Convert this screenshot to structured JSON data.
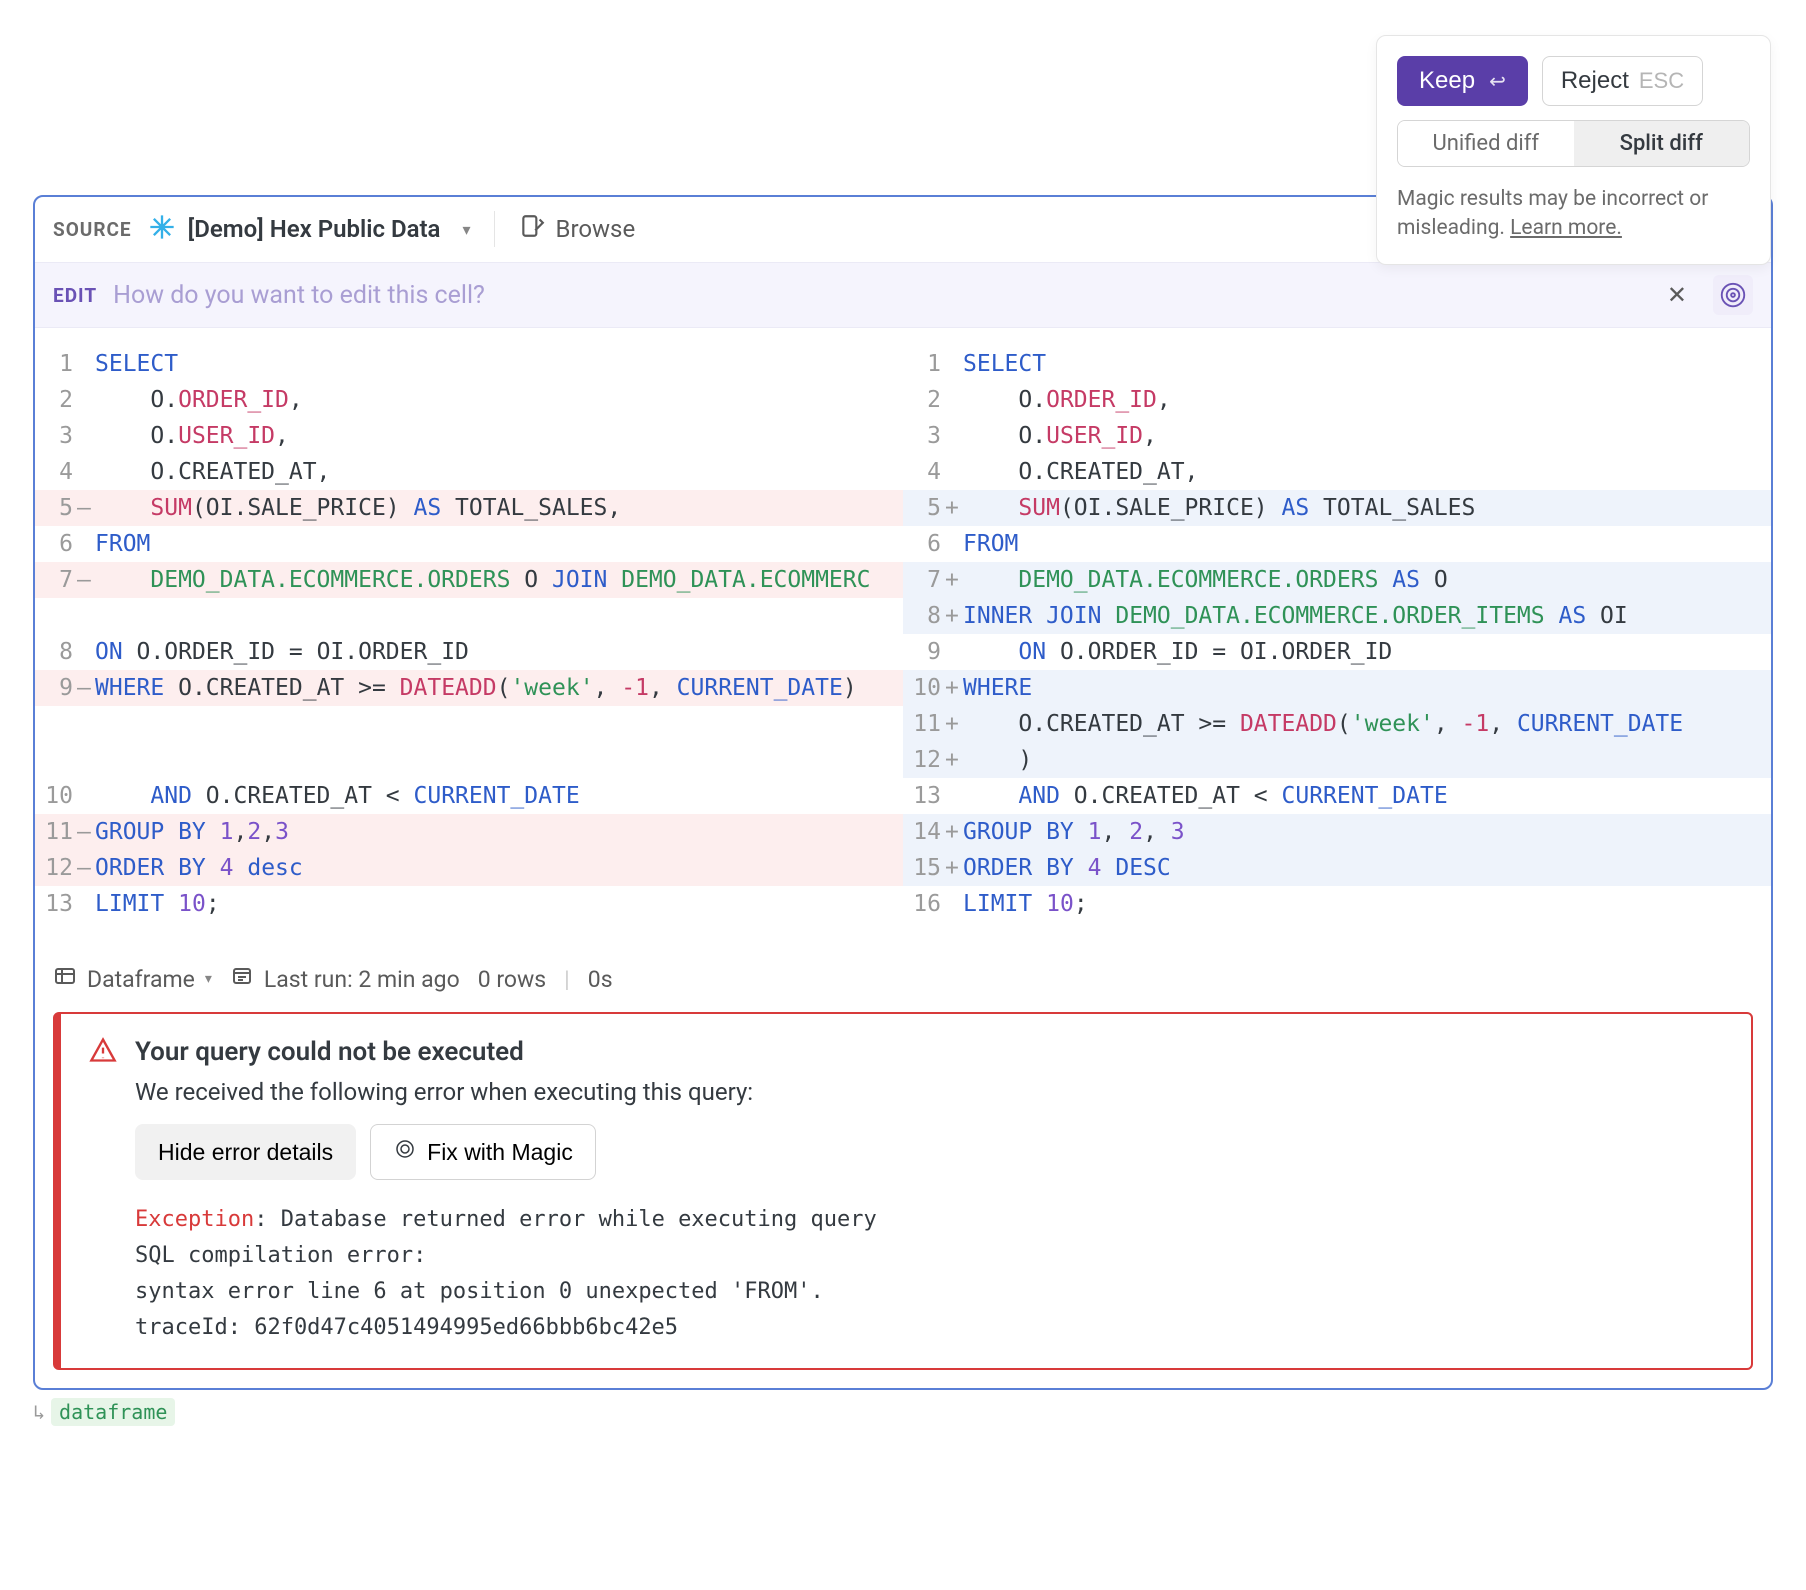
{
  "popup": {
    "keep": "Keep",
    "reject": "Reject",
    "esc": "ESC",
    "unified": "Unified diff",
    "split": "Split diff",
    "hint_prefix": "Magic results may be incorrect or misleading. ",
    "hint_link": "Learn more."
  },
  "header": {
    "source_label": "SOURCE",
    "source_name": "[Demo] Hex Public Data",
    "browse": "Browse"
  },
  "editbar": {
    "label": "EDIT",
    "placeholder": "How do you want to edit this cell?"
  },
  "diff": {
    "left": [
      {
        "n": "1",
        "m": "",
        "bg": "",
        "h": "<span class='kw'>SELECT</span>"
      },
      {
        "n": "2",
        "m": "",
        "bg": "",
        "h": "    O.<span class='col'>ORDER_ID</span>,"
      },
      {
        "n": "3",
        "m": "",
        "bg": "",
        "h": "    O.<span class='col'>USER_ID</span>,"
      },
      {
        "n": "4",
        "m": "",
        "bg": "",
        "h": "    O.CREATED_AT,"
      },
      {
        "n": "5",
        "m": "–",
        "bg": "del",
        "h": "    <span class='fn'>SUM</span>(OI.SALE_PRICE) <span class='as'>AS</span> TOTAL_SALES,"
      },
      {
        "n": "6",
        "m": "",
        "bg": "",
        "h": "<span class='kw'>FROM</span>"
      },
      {
        "n": "7",
        "m": "–",
        "bg": "del",
        "h": "    <span class='tbl'>DEMO_DATA.ECOMMERCE.ORDERS</span> O <span class='kw'>JOIN</span> <span class='tbl'>DEMO_DATA.ECOMMERC</span>"
      },
      {
        "n": "",
        "m": "",
        "bg": "",
        "h": "&nbsp;"
      },
      {
        "n": "8",
        "m": "",
        "bg": "",
        "h": "<span class='kw'>ON</span> O.ORDER_ID = OI.ORDER_ID"
      },
      {
        "n": "9",
        "m": "–",
        "bg": "del",
        "h": "<span class='kw'>WHERE</span> O.CREATED_AT &gt;= <span class='fn'>DATEADD</span>(<span class='str'>'week'</span>, <span class='neg1'>-1</span>, <span class='kw'>CURRENT_DATE</span>)"
      },
      {
        "n": "",
        "m": "",
        "bg": "",
        "h": "&nbsp;"
      },
      {
        "n": "",
        "m": "",
        "bg": "",
        "h": "&nbsp;"
      },
      {
        "n": "10",
        "m": "",
        "bg": "",
        "h": "    <span class='kw'>AND</span> O.CREATED_AT &lt; <span class='kw'>CURRENT_DATE</span>"
      },
      {
        "n": "11",
        "m": "–",
        "bg": "del",
        "h": "<span class='kw'>GROUP BY</span> <span class='num'>1</span>,<span class='num'>2</span>,<span class='num'>3</span>"
      },
      {
        "n": "12",
        "m": "–",
        "bg": "del",
        "h": "<span class='kw'>ORDER BY</span> <span class='num'>4</span> <span class='kw'>desc</span>"
      },
      {
        "n": "13",
        "m": "",
        "bg": "",
        "h": "<span class='kw'>LIMIT</span> <span class='num'>10</span>;"
      }
    ],
    "right": [
      {
        "n": "1",
        "m": "",
        "bg": "",
        "h": "<span class='kw'>SELECT</span>"
      },
      {
        "n": "2",
        "m": "",
        "bg": "",
        "h": "    O.<span class='col'>ORDER_ID</span>,"
      },
      {
        "n": "3",
        "m": "",
        "bg": "",
        "h": "    O.<span class='col'>USER_ID</span>,"
      },
      {
        "n": "4",
        "m": "",
        "bg": "",
        "h": "    O.CREATED_AT,"
      },
      {
        "n": "5",
        "m": "+",
        "bg": "add",
        "h": "    <span class='fn'>SUM</span>(OI.SALE_PRICE) <span class='as'>AS</span> TOTAL_SALES"
      },
      {
        "n": "6",
        "m": "",
        "bg": "",
        "h": "<span class='kw'>FROM</span>"
      },
      {
        "n": "7",
        "m": "+",
        "bg": "add",
        "h": "    <span class='tbl'>DEMO_DATA.ECOMMERCE.ORDERS</span> <span class='as'>AS</span> O"
      },
      {
        "n": "8",
        "m": "+",
        "bg": "add",
        "h": "<span class='kw'>INNER JOIN</span> <span class='tbl'>DEMO_DATA.ECOMMERCE.ORDER_ITEMS</span> <span class='as'>AS</span> OI"
      },
      {
        "n": "9",
        "m": "",
        "bg": "",
        "h": "    <span class='kw'>ON</span> O.ORDER_ID = OI.ORDER_ID"
      },
      {
        "n": "10",
        "m": "+",
        "bg": "add",
        "h": "<span class='kw'>WHERE</span>"
      },
      {
        "n": "11",
        "m": "+",
        "bg": "add",
        "h": "    O.CREATED_AT &gt;= <span class='fn'>DATEADD</span>(<span class='str'>'week'</span>, <span class='neg1'>-1</span>, <span class='kw'>CURRENT_DATE</span>"
      },
      {
        "n": "12",
        "m": "+",
        "bg": "add",
        "h": "    <span class='txt'>)</span>"
      },
      {
        "n": "13",
        "m": "",
        "bg": "",
        "h": "    <span class='kw'>AND</span> O.CREATED_AT &lt; <span class='kw'>CURRENT_DATE</span>"
      },
      {
        "n": "14",
        "m": "+",
        "bg": "add",
        "h": "<span class='kw'>GROUP BY</span> <span class='num'>1</span>, <span class='num'>2</span>, <span class='num'>3</span>"
      },
      {
        "n": "15",
        "m": "+",
        "bg": "add",
        "h": "<span class='kw'>ORDER BY</span> <span class='num'>4</span> <span class='kw'>DESC</span>"
      },
      {
        "n": "16",
        "m": "",
        "bg": "",
        "h": "<span class='kw'>LIMIT</span> <span class='num'>10</span>;"
      }
    ]
  },
  "status": {
    "dataframe": "Dataframe",
    "last_run": "Last run: 2 min ago",
    "rows": "0 rows",
    "time": "0s"
  },
  "error": {
    "title": "Your query could not be executed",
    "sub": "We received the following error when executing this query:",
    "hide_btn": "Hide error details",
    "fix_btn": "Fix with Magic",
    "exc_label": "Exception",
    "exc_rest": ": Database returned error while executing query",
    "l2": "SQL compilation error:",
    "l3": "syntax error line 6 at position 0 unexpected 'FROM'.",
    "l4": "traceId: 62f0d47c4051494995ed66bbb6bc42e5"
  },
  "outref": {
    "name": "dataframe"
  }
}
